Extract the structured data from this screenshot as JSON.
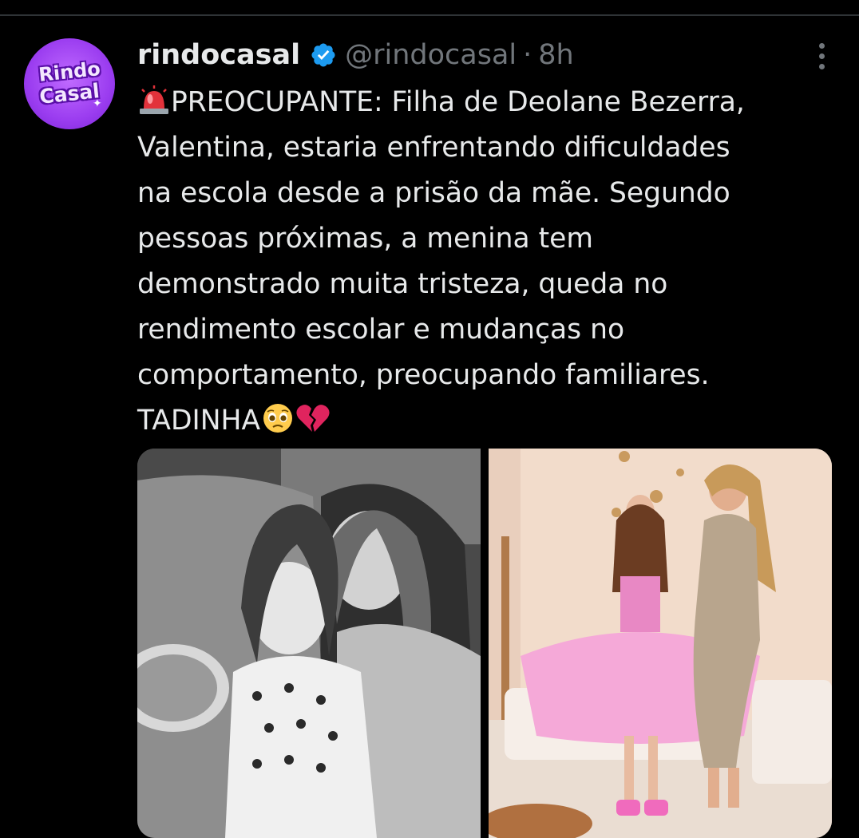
{
  "tweet": {
    "display_name": "rindocasal",
    "handle": "@rindocasal",
    "separator": "·",
    "time": "8h",
    "avatar_text_top": "Rindo",
    "avatar_text_bottom": "Casal",
    "lines": [
      "PREOCUPANTE: Filha de Deolane Bezerra,",
      "Valentina, estaria enfrentando dificuldades",
      "na escola desde a prisão da mãe. Segundo",
      "pessoas próximas, a menina tem",
      "demonstrado muita tristeza, queda no",
      "rendimento escolar e mudanças no",
      "comportamento, preocupando familiares.",
      "TADINHA"
    ],
    "emojis": [
      "rotating-light-icon",
      "pleading-face-icon",
      "broken-heart-icon"
    ]
  },
  "colors": {
    "background": "#000000",
    "text": "#e7e9ea",
    "secondary": "#71767b",
    "verified": "#1d9bf0",
    "avatar": "#9b3df0"
  }
}
